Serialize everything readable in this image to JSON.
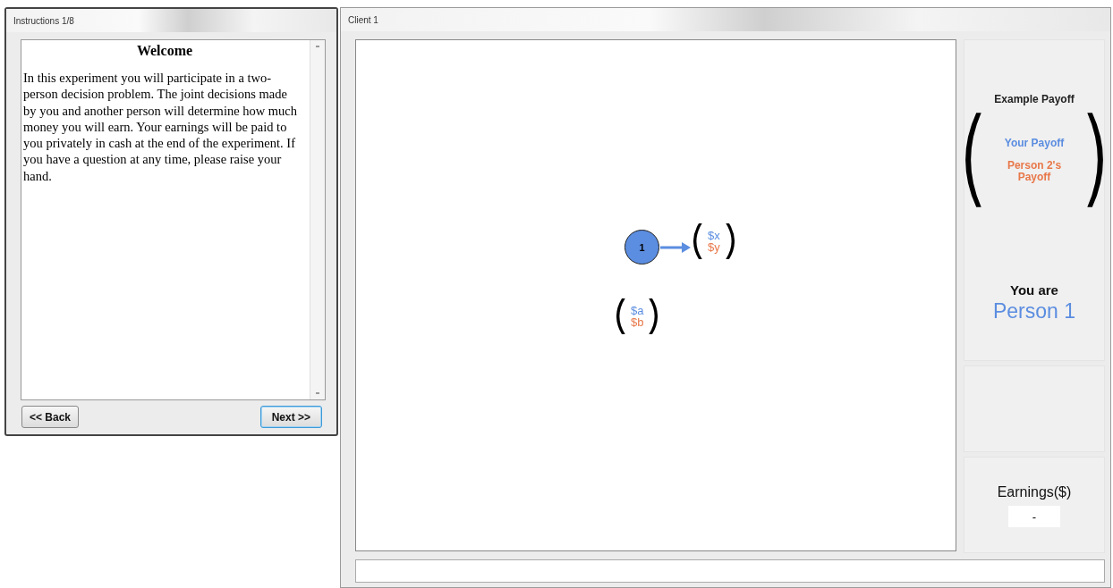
{
  "instructions_window": {
    "title": "Instructions 1/8",
    "heading": "Welcome",
    "body": "In this experiment you will participate in a two-person decision problem.  The joint decisions made by you and another person will determine how much money you will earn.  Your earnings will be paid to you privately in cash at the end of the experiment.  If you have a question at any time, please raise your hand.",
    "buttons": [
      {
        "label": "<< Back",
        "focused": false
      },
      {
        "label": "Next >>",
        "focused": true
      }
    ]
  },
  "client_window": {
    "title": "Client 1",
    "tree": {
      "node": {
        "label": "1"
      },
      "payoffs": [
        {
          "top": "$x",
          "bottom": "$y",
          "linked": true
        },
        {
          "top": "$a",
          "bottom": "$b",
          "linked": false
        }
      ]
    },
    "example_payoff": {
      "title": "Example Payoff",
      "your_payoff": "Your Payoff",
      "other_payoff": "Person 2's Payoff"
    },
    "identity": {
      "label": "You are",
      "value": "Person 1"
    },
    "earnings": {
      "label": "Earnings($)",
      "value": "-"
    }
  }
}
